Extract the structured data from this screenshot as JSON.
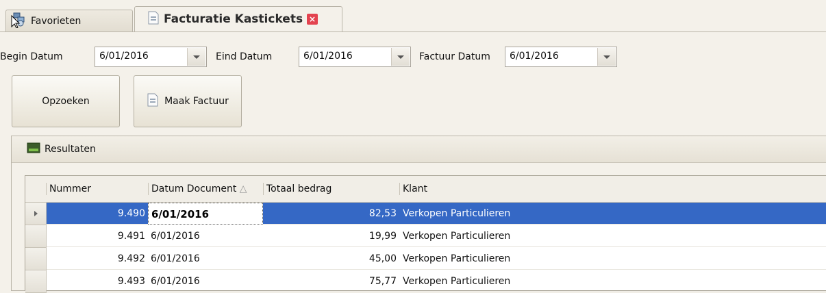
{
  "tabs": [
    {
      "label": "Favorieten",
      "icon": "favorites-icon"
    },
    {
      "label": "Facturatie Kastickets",
      "icon": "document-icon",
      "closable": true
    }
  ],
  "filters": {
    "begin_label": "Begin Datum",
    "begin_value": "6/01/2016",
    "eind_label": "Eind Datum",
    "eind_value": "6/01/2016",
    "factuur_label": "Factuur Datum",
    "factuur_value": "6/01/2016"
  },
  "buttons": {
    "search": "Opzoeken",
    "invoice": "Maak Factuur"
  },
  "results": {
    "title": "Resultaten",
    "columns": [
      "Nummer",
      "Datum Document",
      "Totaal bedrag",
      "Klant"
    ],
    "sort_indicator": "△",
    "rows": [
      {
        "nummer": "9.490",
        "datum": "6/01/2016",
        "bedrag": "82,53",
        "klant": "Verkopen Particulieren"
      },
      {
        "nummer": "9.491",
        "datum": "6/01/2016",
        "bedrag": "19,99",
        "klant": "Verkopen Particulieren"
      },
      {
        "nummer": "9.492",
        "datum": "6/01/2016",
        "bedrag": "45,00",
        "klant": "Verkopen Particulieren"
      },
      {
        "nummer": "9.493",
        "datum": "6/01/2016",
        "bedrag": "75,77",
        "klant": "Verkopen Particulieren"
      }
    ]
  },
  "colors": {
    "selection": "#3568c5",
    "close": "#e3434f"
  }
}
